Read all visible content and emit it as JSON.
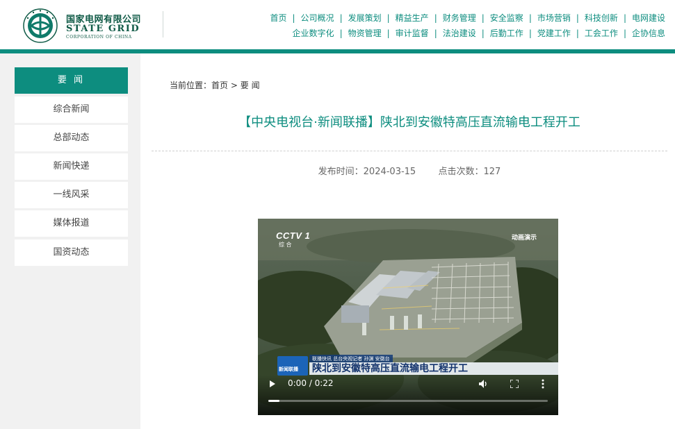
{
  "header": {
    "logo_cn": "国家电网有限公司",
    "logo_en": "STATE GRID",
    "logo_en_sub": "CORPORATION OF CHINA",
    "nav_row1": [
      "首页",
      "公司概况",
      "发展策划",
      "精益生产",
      "财务管理",
      "安全监察",
      "市场营销",
      "科技创新",
      "电网建设"
    ],
    "nav_row2": [
      "企业数字化",
      "物资管理",
      "审计监督",
      "法治建设",
      "后勤工作",
      "党建工作",
      "工会工作",
      "企协信息"
    ],
    "nav_separator": "|"
  },
  "sidebar": {
    "items": [
      {
        "label": "要 闻",
        "active": true
      },
      {
        "label": "综合新闻",
        "active": false
      },
      {
        "label": "总部动态",
        "active": false
      },
      {
        "label": "新闻快递",
        "active": false
      },
      {
        "label": "一线风采",
        "active": false
      },
      {
        "label": "媒体报道",
        "active": false
      },
      {
        "label": "国资动态",
        "active": false
      }
    ]
  },
  "breadcrumb": {
    "prefix": "当前位置：",
    "home": "首页",
    "separator": ">",
    "current": "要 闻"
  },
  "article": {
    "title": "【中央电视台·新闻联播】陕北到安徽特高压直流输电工程开工",
    "publish_label": "发布时间：",
    "publish_date": "2024-03-15",
    "clicks_label": "点击次数：",
    "clicks": "127"
  },
  "video": {
    "channel_logo": "CCTV 1",
    "channel_sub": "综 合",
    "overlay_label": "动画演示",
    "ticker_badge": "新闻联播",
    "ticker_top": "联播快讯  总台央视记者 孙渊 安徽台",
    "ticker_headline": "陕北到安徽特高压直流输电工程开工",
    "time": "0:00 / 0:22",
    "progress_fraction": 0.04
  },
  "colors": {
    "brand": "#0d8d7f",
    "brand_dark": "#0f5a46",
    "sidebar_bg": "#f1f1f1"
  }
}
